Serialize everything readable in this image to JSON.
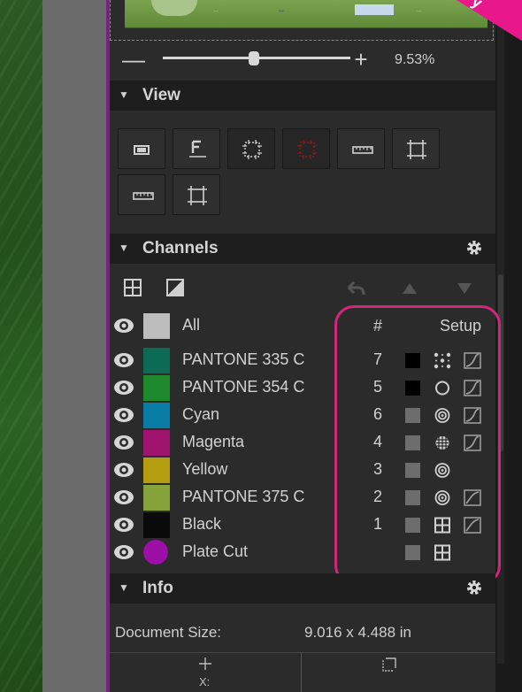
{
  "corner_label": "y",
  "thumbnail": {
    "text1": "...",
    "text2": "...",
    "text3": "..."
  },
  "zoom": {
    "minus_label": "—",
    "plus_label": "+",
    "value": "9.53%"
  },
  "view": {
    "title": "View",
    "buttons": [
      "frame-icon",
      "baseline-icon",
      "crop-dotted-icon",
      "crop-red-icon",
      "ruler-icon",
      "crop-marks-icon",
      "ruler-icon",
      "crop-marks-icon"
    ]
  },
  "channels": {
    "title": "Channels",
    "header": {
      "num": "#",
      "setup": "Setup"
    },
    "rows": [
      {
        "name": "All",
        "color": "#bdbdbd",
        "num": "",
        "box": "",
        "icon": "",
        "curve": ""
      },
      {
        "name": "PANTONE 335 C",
        "color": "#0d6b55",
        "num": "7",
        "box": "#000000",
        "icon": "dots-icon",
        "curve": "curve-icon"
      },
      {
        "name": "PANTONE 354 C",
        "color": "#1e8a2d",
        "num": "5",
        "box": "#000000",
        "icon": "circle-icon",
        "curve": "curve-icon"
      },
      {
        "name": "Cyan",
        "color": "#0a7da6",
        "num": "6",
        "box": "#6d6d6d",
        "icon": "target-icon",
        "curve": "curve-icon"
      },
      {
        "name": "Magenta",
        "color": "#a01470",
        "num": "4",
        "box": "#6d6d6d",
        "icon": "grid-circle-icon",
        "curve": "curve-icon"
      },
      {
        "name": "Yellow",
        "color": "#b59e0f",
        "num": "3",
        "box": "#6d6d6d",
        "icon": "target-icon",
        "curve": ""
      },
      {
        "name": "PANTONE 375 C",
        "color": "#85a33a",
        "num": "2",
        "box": "#6d6d6d",
        "icon": "target-icon",
        "curve": "curve-flat-icon"
      },
      {
        "name": "Black",
        "color": "#0a0a0a",
        "num": "1",
        "box": "#6d6d6d",
        "icon": "grid-square-icon",
        "curve": "curve-flat-icon"
      },
      {
        "name": "Plate Cut",
        "color": "#9b0fa6",
        "num": "",
        "box": "#6d6d6d",
        "icon": "grid-square-icon",
        "curve": ""
      }
    ]
  },
  "info": {
    "title": "Info",
    "document_size_label": "Document Size:",
    "document_size_value": "9.016 x 4.488 in"
  },
  "bottom": {
    "left_label": "X:"
  },
  "colors": {
    "highlight": "#d4257d",
    "purple_edge": "#7a1f86",
    "ribbon": "#e8188a"
  }
}
